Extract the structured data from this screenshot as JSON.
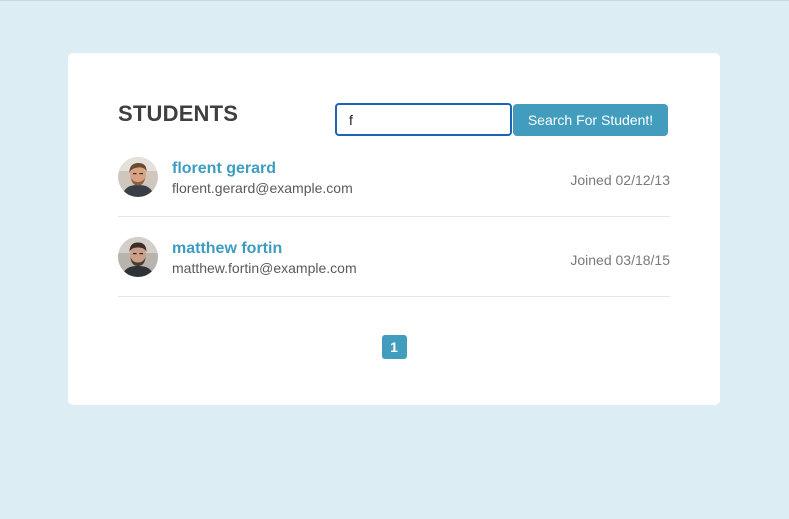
{
  "header": {
    "title": "STUDENTS"
  },
  "search": {
    "value": "f",
    "button_label": "Search For Student!"
  },
  "students": [
    {
      "name": "florent gerard",
      "email": "florent.gerard@example.com",
      "joined": "Joined 02/12/13"
    },
    {
      "name": "matthew fortin",
      "email": "matthew.fortin@example.com",
      "joined": "Joined 03/18/15"
    }
  ],
  "pagination": {
    "pages": [
      "1"
    ],
    "current": "1"
  },
  "colors": {
    "background": "#ddedf4",
    "accent": "#429cbd",
    "name_link": "#3d9cbf",
    "input_border": "#1d63b6"
  }
}
